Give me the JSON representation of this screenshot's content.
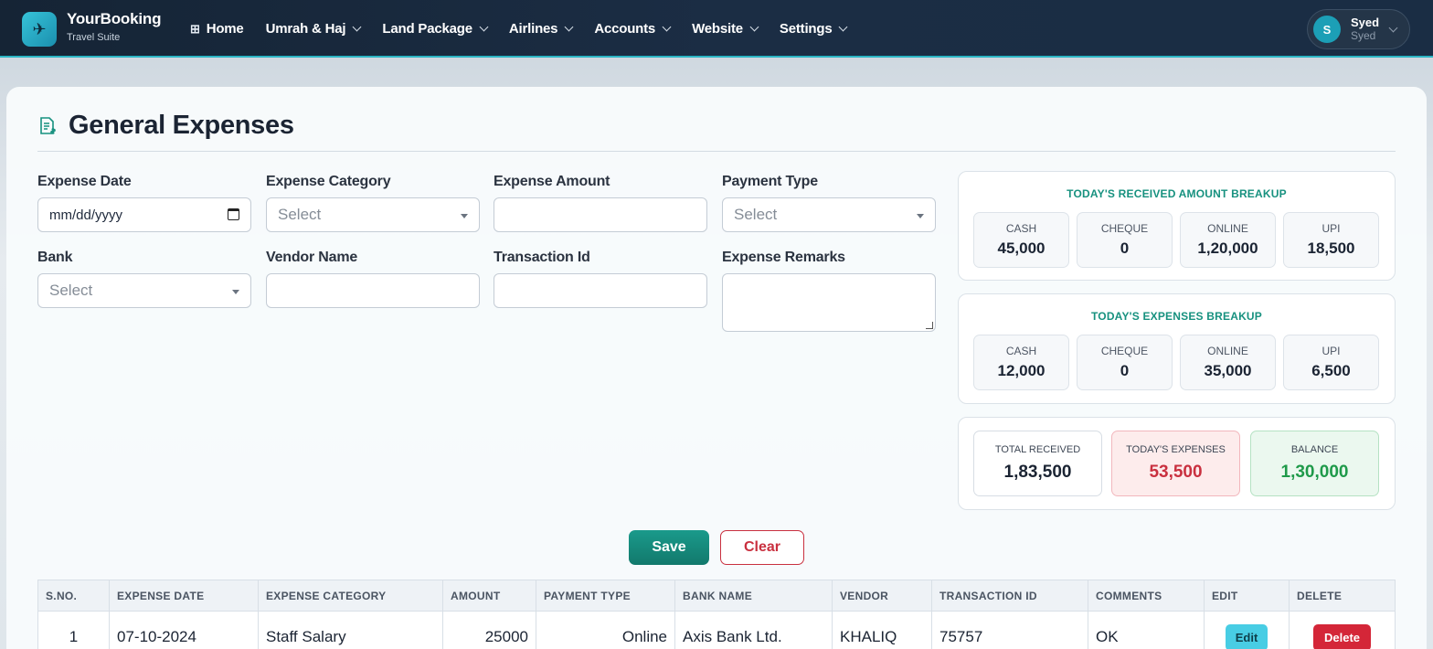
{
  "brand": {
    "name": "YourBooking",
    "subtitle": "Travel Suite"
  },
  "nav": [
    {
      "label": "Home"
    },
    {
      "label": "Umrah & Haj"
    },
    {
      "label": "Land Package"
    },
    {
      "label": "Airlines"
    },
    {
      "label": "Accounts"
    },
    {
      "label": "Website"
    },
    {
      "label": "Settings"
    }
  ],
  "user": {
    "initial": "S",
    "name": "Syed",
    "role": "Syed"
  },
  "page": {
    "title": "General Expenses"
  },
  "form": {
    "expense_date": {
      "label": "Expense Date",
      "value": "mm/dd/yyyy"
    },
    "expense_category": {
      "label": "Expense Category",
      "value": "Select"
    },
    "expense_amount": {
      "label": "Expense Amount",
      "value": ""
    },
    "payment_type": {
      "label": "Payment Type",
      "value": "Select"
    },
    "bank": {
      "label": "Bank",
      "value": "Select"
    },
    "vendor_name": {
      "label": "Vendor Name",
      "value": ""
    },
    "transaction_id": {
      "label": "Transaction Id",
      "value": ""
    },
    "expense_remarks": {
      "label": "Expense Remarks",
      "value": ""
    }
  },
  "received_breakup": {
    "title": "TODAY'S RECEIVED AMOUNT BREAKUP",
    "tiles": [
      {
        "label": "CASH",
        "value": "45,000"
      },
      {
        "label": "CHEQUE",
        "value": "0"
      },
      {
        "label": "ONLINE",
        "value": "1,20,000"
      },
      {
        "label": "UPI",
        "value": "18,500"
      }
    ]
  },
  "expenses_breakup": {
    "title": "TODAY'S EXPENSES BREAKUP",
    "tiles": [
      {
        "label": "CASH",
        "value": "12,000"
      },
      {
        "label": "CHEQUE",
        "value": "0"
      },
      {
        "label": "ONLINE",
        "value": "35,000"
      },
      {
        "label": "UPI",
        "value": "6,500"
      }
    ]
  },
  "summary": {
    "total_received": {
      "label": "TOTAL RECEIVED",
      "value": "1,83,500"
    },
    "todays_expenses": {
      "label": "TODAY'S EXPENSES",
      "value": "53,500"
    },
    "balance": {
      "label": "BALANCE",
      "value": "1,30,000"
    }
  },
  "actions": {
    "save": "Save",
    "clear": "Clear"
  },
  "table": {
    "headers": [
      "S.NO.",
      "EXPENSE DATE",
      "EXPENSE CATEGORY",
      "AMOUNT",
      "PAYMENT TYPE",
      "BANK NAME",
      "VENDOR",
      "TRANSACTION ID",
      "COMMENTS",
      "EDIT",
      "DELETE"
    ],
    "rows": [
      {
        "sno": "1",
        "date": "07-10-2024",
        "category": "Staff Salary",
        "amount": "25000",
        "payment_type": "Online",
        "bank": "Axis Bank Ltd.",
        "vendor": "KHALIQ",
        "txn": "75757",
        "comments": "OK",
        "edit": "Edit",
        "delete": "Delete"
      }
    ]
  },
  "colors": {
    "accent": "#17917f",
    "danger": "#c9303f",
    "success": "#1f9a4a",
    "topbar": "#1b2d44"
  }
}
